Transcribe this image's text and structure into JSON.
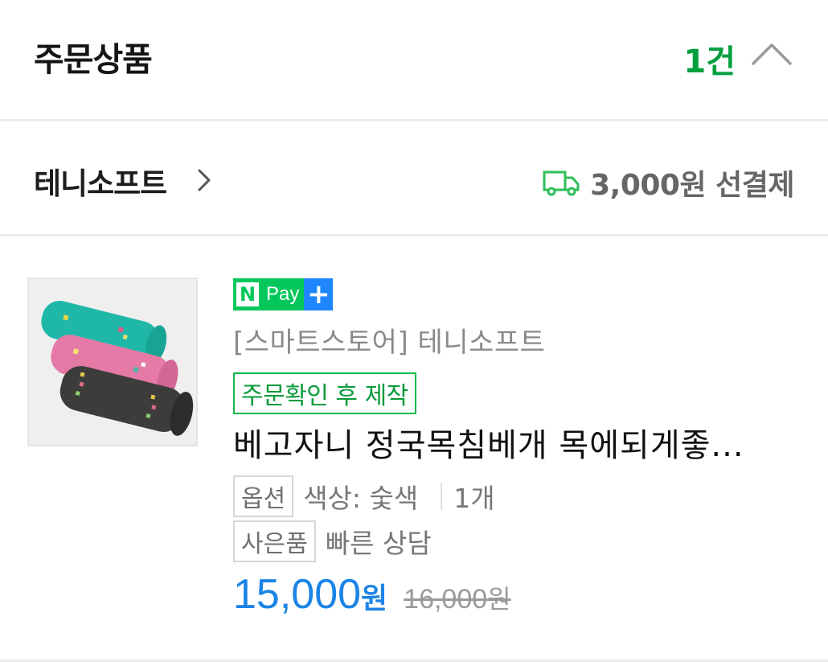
{
  "header": {
    "title": "주문상품",
    "count": "1건"
  },
  "seller": {
    "name": "테니소프트",
    "shipping": "3,000원 선결제"
  },
  "product": {
    "npay_label": "Pay",
    "npay_n": "N",
    "npay_plus": "+",
    "store": "[스마트스토어] 테니소프트",
    "made_badge": "주문확인 후 제작",
    "name": "베고자니 정국목침베개 목에되게좋...",
    "option_tag": "옵션",
    "option_value": "색상: 숯색",
    "quantity": "1개",
    "gift_tag": "사은품",
    "gift_value": "빠른 상담",
    "price": "15,000",
    "price_unit": "원",
    "original_price": "16,000",
    "original_unit": "원"
  },
  "colors": {
    "brand_green": "#03c75a",
    "count_green": "#04a03e",
    "price_blue": "#1c84e6",
    "npay_plus_blue": "#1e87ff"
  }
}
